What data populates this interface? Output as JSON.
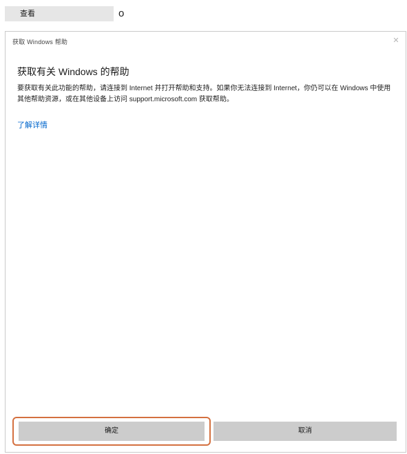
{
  "top": {
    "button_label": "查看",
    "glyph": "o"
  },
  "dialog": {
    "title": "获取 Windows 帮助",
    "close_glyph": "✕",
    "heading": "获取有关 Windows 的帮助",
    "body": "要获取有关此功能的帮助，请连接到 Internet 并打开帮助和支持。如果你无法连接到 Internet，你仍可以在 Windows 中使用其他帮助资源，或在其他设备上访问 support.microsoft.com 获取帮助。",
    "link": "了解详情"
  },
  "buttons": {
    "primary_label": "确定",
    "secondary_label": "取消"
  },
  "colors": {
    "focus_ring": "#d4703f",
    "link": "#0066cc",
    "button_bg": "#cccccc"
  }
}
